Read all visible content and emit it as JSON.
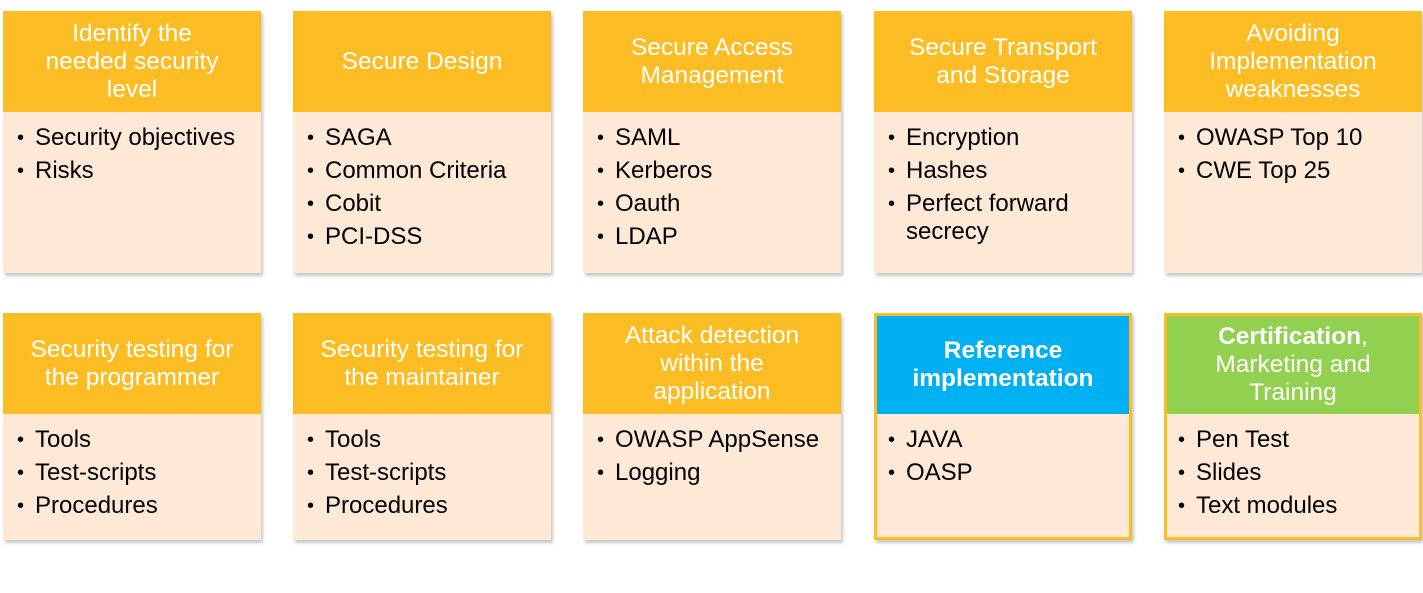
{
  "cards": [
    {
      "title": "Identify the\nneeded security\nlevel",
      "items": [
        "Security objectives",
        "Risks"
      ]
    },
    {
      "title": "Secure Design",
      "items": [
        "SAGA",
        "Common Criteria",
        "Cobit",
        "PCI-DSS"
      ]
    },
    {
      "title": "Secure Access\nManagement",
      "items": [
        "SAML",
        "Kerberos",
        "Oauth",
        "LDAP"
      ]
    },
    {
      "title": "Secure Transport\nand Storage",
      "items": [
        "Encryption",
        "Hashes",
        "Perfect forward secrecy"
      ]
    },
    {
      "title": "Avoiding\nImplementation\nweaknesses",
      "items": [
        "OWASP Top 10",
        "CWE Top 25"
      ]
    },
    {
      "title": "Security testing for\nthe programmer",
      "items": [
        "Tools",
        "Test-scripts",
        "Procedures"
      ]
    },
    {
      "title": "Security testing for\nthe maintainer",
      "items": [
        "Tools",
        "Test-scripts",
        "Procedures"
      ]
    },
    {
      "title": "Attack detection\nwithin the\napplication",
      "items": [
        "OWASP AppSense",
        "Logging"
      ]
    },
    {
      "title": "Reference\nimplementation",
      "items": [
        "JAVA",
        "OASP"
      ]
    },
    {
      "title_bold": "Certification",
      "title_rest": ",\nMarketing and\nTraining",
      "items": [
        "Pen Test",
        "Slides",
        "Text modules"
      ]
    }
  ],
  "colors": {
    "header": "#fbbc24",
    "body": "#fde9d5",
    "highlight_blue": "#00b0f0",
    "highlight_green": "#92d050"
  }
}
